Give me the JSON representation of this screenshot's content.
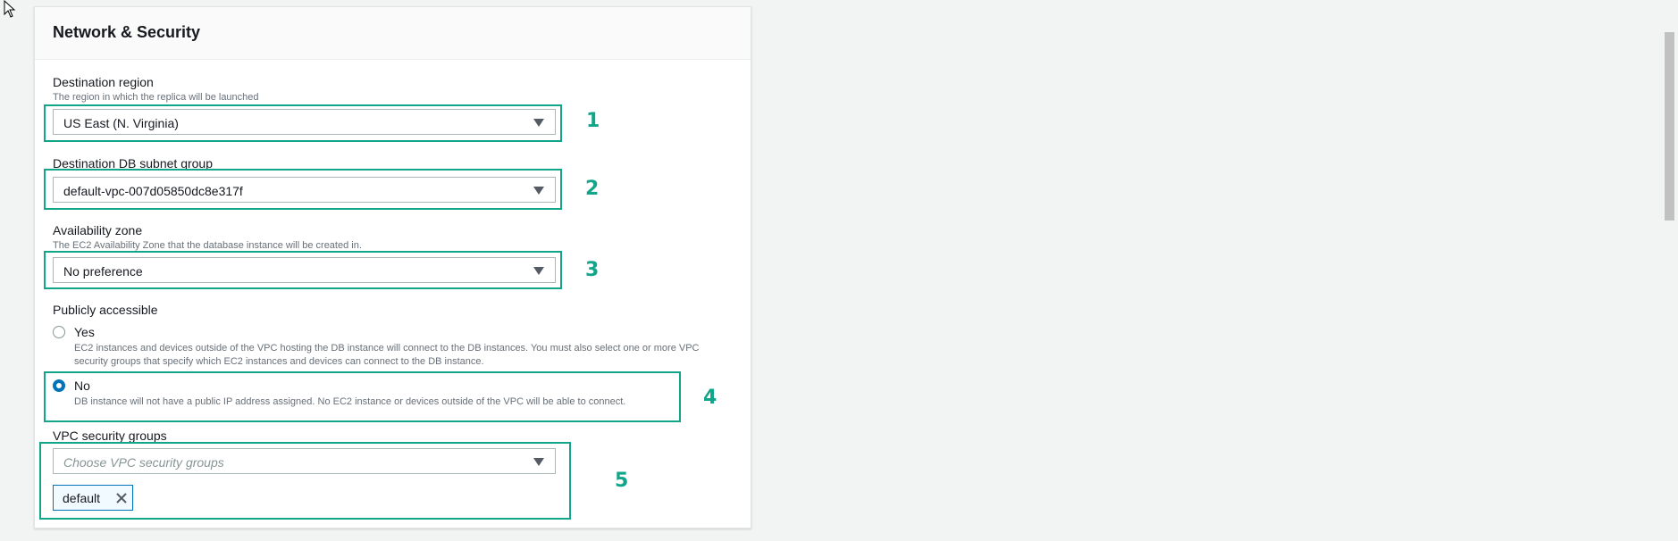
{
  "panel": {
    "title": "Network & Security"
  },
  "destination_region": {
    "label": "Destination region",
    "description": "The region in which the replica will be launched",
    "value": "US East (N. Virginia)"
  },
  "subnet_group": {
    "label": "Destination DB subnet group",
    "value": "default-vpc-007d05850dc8e317f"
  },
  "availability_zone": {
    "label": "Availability zone",
    "description": "The EC2 Availability Zone that the database instance will be created in.",
    "value": "No preference"
  },
  "publicly_accessible": {
    "label": "Publicly accessible",
    "options": [
      {
        "label": "Yes",
        "description": "EC2 instances and devices outside of the VPC hosting the DB instance will connect to the DB instances. You must also select one or more VPC security groups that specify which EC2 instances and devices can connect to the DB instance.",
        "selected": false
      },
      {
        "label": "No",
        "description": "DB instance will not have a public IP address assigned. No EC2 instance or devices outside of the VPC will be able to connect.",
        "selected": true
      }
    ]
  },
  "vpc_security_groups": {
    "label": "VPC security groups",
    "placeholder": "Choose VPC security groups",
    "selected_tokens": [
      "default"
    ]
  },
  "annotations": [
    "1",
    "2",
    "3",
    "4",
    "5"
  ],
  "colors": {
    "annotation": "#12a589",
    "radio_selected": "#0073bb"
  },
  "icons": {
    "select_caret": "caret-down-icon",
    "token_remove": "close-icon",
    "cursor": "mouse-pointer-icon"
  }
}
